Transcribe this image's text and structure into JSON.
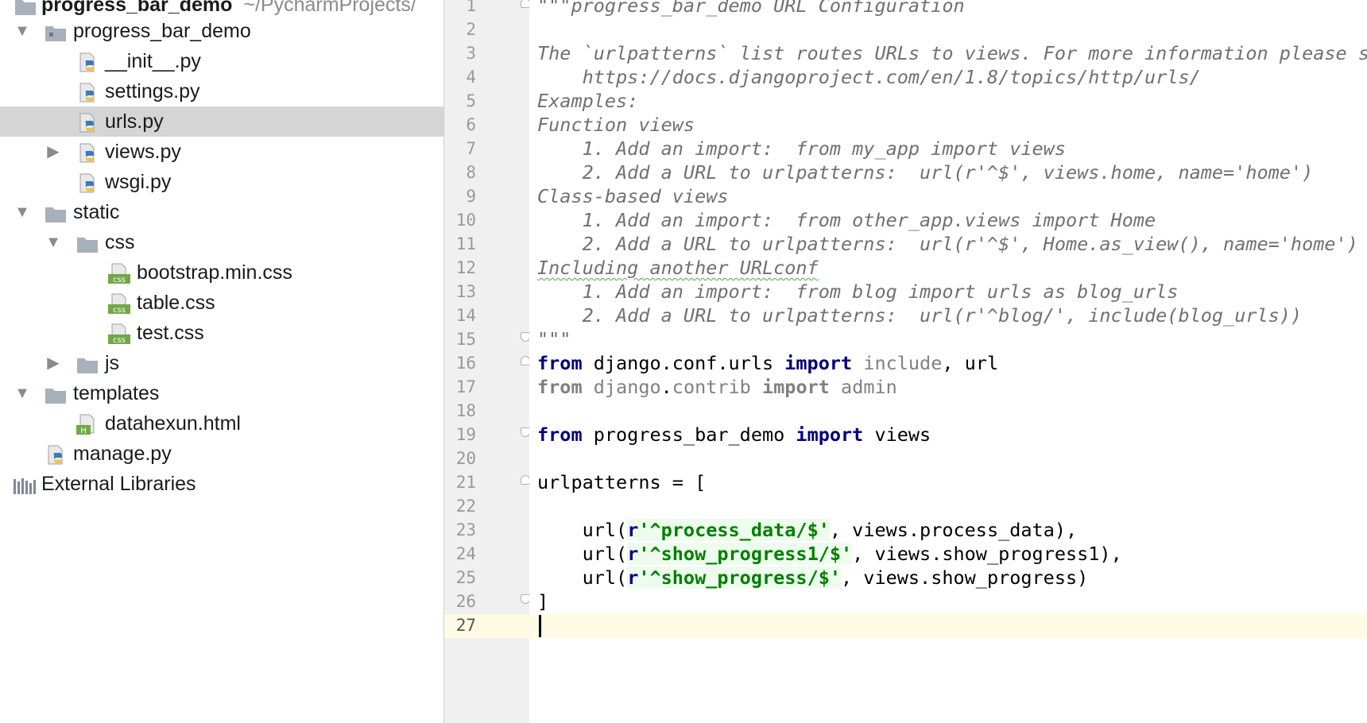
{
  "project_tree": {
    "rows": [
      {
        "label": "progress_bar_demo",
        "sublabel": "~/PycharmProjects/",
        "kind": "root-folder",
        "icon": "folder-icon",
        "arrow": ""
      },
      {
        "label": "progress_bar_demo",
        "kind": "folder",
        "icon": "package-folder-icon",
        "arrow": "▼"
      },
      {
        "label": "__init__.py",
        "kind": "file",
        "icon": "python-file-icon",
        "arrow": ""
      },
      {
        "label": "settings.py",
        "kind": "file",
        "icon": "python-file-icon",
        "arrow": ""
      },
      {
        "label": "urls.py",
        "kind": "file",
        "icon": "python-file-icon",
        "arrow": "",
        "selected": true
      },
      {
        "label": "views.py",
        "kind": "file",
        "icon": "python-file-icon",
        "arrow": "▶"
      },
      {
        "label": "wsgi.py",
        "kind": "file",
        "icon": "python-file-icon",
        "arrow": ""
      },
      {
        "label": "static",
        "kind": "folder",
        "icon": "folder-icon",
        "arrow": "▼"
      },
      {
        "label": "css",
        "kind": "folder",
        "icon": "folder-icon",
        "arrow": "▼"
      },
      {
        "label": "bootstrap.min.css",
        "kind": "file",
        "icon": "css-file-icon",
        "arrow": ""
      },
      {
        "label": "table.css",
        "kind": "file",
        "icon": "css-file-icon",
        "arrow": ""
      },
      {
        "label": "test.css",
        "kind": "file",
        "icon": "css-file-icon",
        "arrow": ""
      },
      {
        "label": "js",
        "kind": "folder",
        "icon": "folder-icon",
        "arrow": "▶"
      },
      {
        "label": "templates",
        "kind": "folder",
        "icon": "folder-icon",
        "arrow": "▼"
      },
      {
        "label": "datahexun.html",
        "kind": "file",
        "icon": "html-file-icon",
        "arrow": ""
      },
      {
        "label": "manage.py",
        "kind": "file",
        "icon": "python-file-icon",
        "arrow": ""
      },
      {
        "label": "External Libraries",
        "kind": "library",
        "icon": "external-libraries-icon",
        "arrow": ""
      }
    ],
    "css_icon_text": "css",
    "html_icon_text": "H"
  },
  "editor": {
    "current_line": 27,
    "lines": [
      {
        "n": "1",
        "t": "\"\"\"progress_bar_demo URL Configuration"
      },
      {
        "n": "2",
        "t": ""
      },
      {
        "n": "3",
        "t": "The `urlpatterns` list routes URLs to views. For more information please se"
      },
      {
        "n": "4",
        "t": "    https://docs.djangoproject.com/en/1.8/topics/http/urls/"
      },
      {
        "n": "5",
        "t": "Examples:"
      },
      {
        "n": "6",
        "t": "Function views"
      },
      {
        "n": "7",
        "t": "    1. Add an import:  from my_app import views"
      },
      {
        "n": "8",
        "t": "    2. Add a URL to urlpatterns:  url(r'^$', views.home, name='home')"
      },
      {
        "n": "9",
        "t": "Class-based views"
      },
      {
        "n": "10",
        "t": "    1. Add an import:  from other_app.views import Home"
      },
      {
        "n": "11",
        "t": "    2. Add a URL to urlpatterns:  url(r'^$', Home.as_view(), name='home')"
      },
      {
        "n": "12",
        "t": "Including another URLconf"
      },
      {
        "n": "13",
        "t": "    1. Add an import:  from blog import urls as blog_urls"
      },
      {
        "n": "14",
        "t": "    2. Add a URL to urlpatterns:  url(r'^blog/', include(blog_urls))"
      },
      {
        "n": "15",
        "t": "\"\"\""
      },
      {
        "n": "16",
        "t": "from django.conf.urls import include, url"
      },
      {
        "n": "17",
        "t": "from django.contrib import admin"
      },
      {
        "n": "18",
        "t": ""
      },
      {
        "n": "19",
        "t": "from progress_bar_demo import views"
      },
      {
        "n": "20",
        "t": ""
      },
      {
        "n": "21",
        "t": "urlpatterns = ["
      },
      {
        "n": "22",
        "t": ""
      },
      {
        "n": "23",
        "t": "    url(r'^process_data/$', views.process_data),"
      },
      {
        "n": "24",
        "t": "    url(r'^show_progress1/$', views.show_progress1),"
      },
      {
        "n": "25",
        "t": "    url(r'^show_progress/$', views.show_progress)"
      },
      {
        "n": "26",
        "t": "]"
      },
      {
        "n": "27",
        "t": ""
      }
    ]
  },
  "colors": {
    "selection": "#d5d5d5",
    "gutter": "#f0f0f0",
    "caret_line": "#fffae3",
    "keyword": "#000080",
    "string": "#008000",
    "docstring": "#707070"
  }
}
